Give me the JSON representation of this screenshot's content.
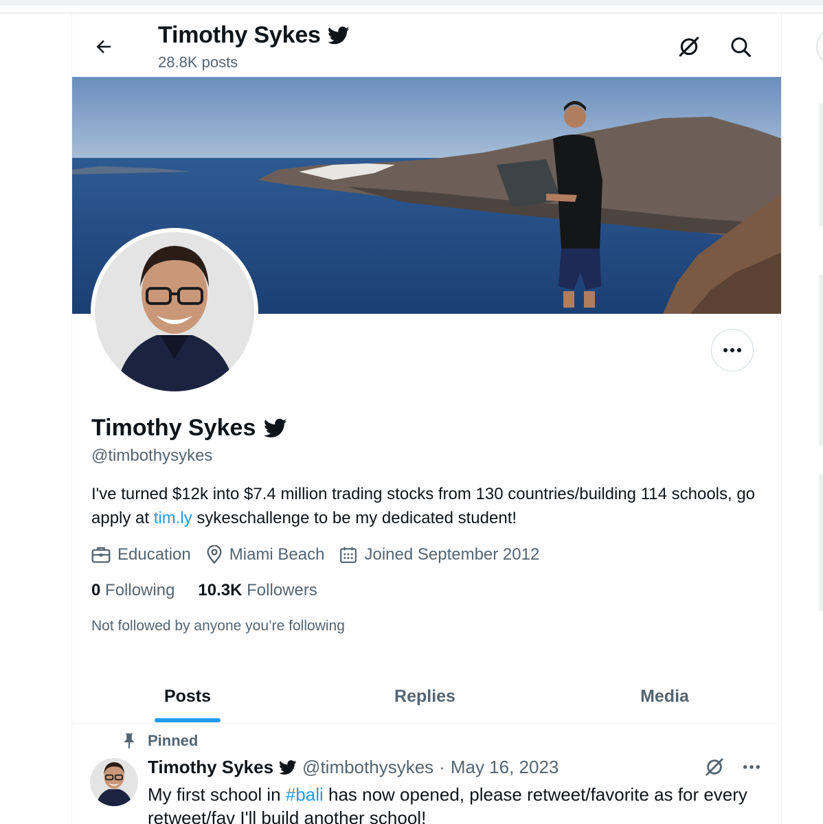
{
  "header": {
    "name": "Timothy Sykes",
    "posts_count": "28.8K posts"
  },
  "icons": {
    "back": "arrow-left-icon",
    "verified": "twitter-bird-icon",
    "grok": "grok-icon",
    "search": "search-icon",
    "more": "more-horizontal-icon",
    "briefcase": "briefcase-icon",
    "location": "location-pin-icon",
    "calendar": "calendar-icon",
    "pin": "pin-icon"
  },
  "profile": {
    "name": "Timothy Sykes",
    "handle": "@timbothysykes",
    "bio_before_link": "I've turned $12k into $7.4 million trading stocks from 130 countries/building 114 schools, go apply at ",
    "bio_link": "tim.ly",
    "bio_after_link": " sykeschallenge to be my dedicated student!",
    "category": "Education",
    "location": "Miami Beach",
    "joined": "Joined September 2012",
    "following_count": "0",
    "following_label": "Following",
    "followers_count": "10.3K",
    "followers_label": "Followers",
    "not_followed": "Not followed by anyone you’re following"
  },
  "tabs": [
    {
      "label": "Posts",
      "active": true
    },
    {
      "label": "Replies",
      "active": false
    },
    {
      "label": "Media",
      "active": false
    }
  ],
  "pinned_post": {
    "pinned_label": "Pinned",
    "author_name": "Timothy Sykes",
    "author_handle": "@timbothysykes",
    "separator": "·",
    "date": "May 16, 2023",
    "text_before_hashtag": "My first school in ",
    "hashtag": "#bali",
    "text_after_hashtag": " has now opened, please retweet/favorite as for every retweet/fav I'll build another school!"
  },
  "colors": {
    "accent": "#1d9bf0",
    "text_primary": "#0f1419",
    "text_secondary": "#536471",
    "border": "#eff3f4"
  }
}
